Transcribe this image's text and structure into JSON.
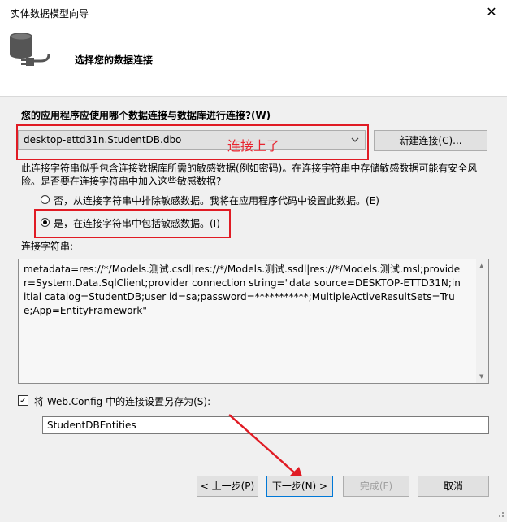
{
  "window": {
    "title": "实体数据模型向导",
    "close_glyph": "✕"
  },
  "header": {
    "step_title": "选择您的数据连接"
  },
  "question": "您的应用程序应使用哪个数据连接与数据库进行连接?(W)",
  "connection": {
    "selected": "desktop-ettd31n.StudentDB.dbo",
    "new_button": "新建连接(C)...",
    "annotation": "连接上了"
  },
  "sensitive": {
    "warning": "此连接字符串似乎包含连接数据库所需的敏感数据(例如密码)。在连接字符串中存储敏感数据可能有安全风险。是否要在连接字符串中加入这些敏感数据?",
    "option_exclude": "否，从连接字符串中排除敏感数据。我将在应用程序代码中设置此数据。(E)",
    "option_include": "是，在连接字符串中包括敏感数据。(I)",
    "selected": "include"
  },
  "connection_string": {
    "label": "连接字符串:",
    "value": "metadata=res://*/Models.测试.csdl|res://*/Models.测试.ssdl|res://*/Models.测试.msl;provider=System.Data.SqlClient;provider connection string=\"data source=DESKTOP-ETTD31N;initial catalog=StudentDB;user id=sa;password=***********;MultipleActiveResultSets=True;App=EntityFramework\""
  },
  "save_config": {
    "checked": true,
    "check_glyph": "✓",
    "label": "将 Web.Config 中的连接设置另存为(S):",
    "value": "StudentDBEntities"
  },
  "buttons": {
    "prev": "< 上一步(P)",
    "next": "下一步(N) >",
    "finish": "完成(F)",
    "cancel": "取消"
  },
  "colors": {
    "annotation": "#e01b24",
    "dialog_bg": "#f0f0f0",
    "focus_border": "#0078d7"
  }
}
